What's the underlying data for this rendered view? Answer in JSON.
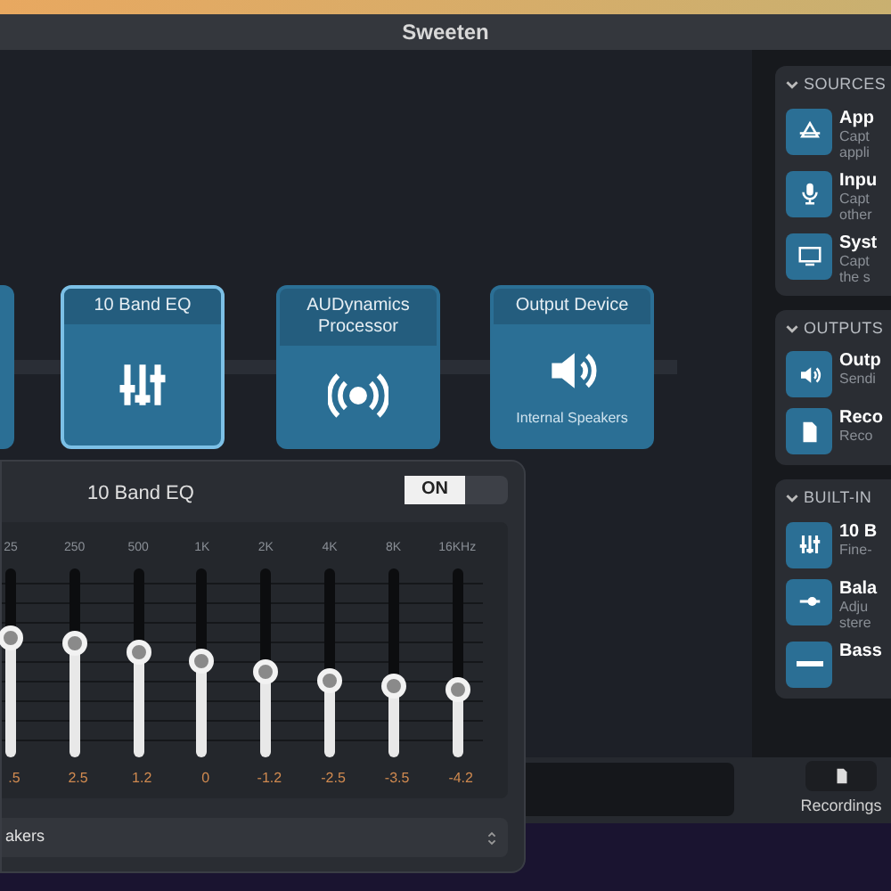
{
  "window": {
    "title": "Sweeten"
  },
  "chain": [
    {
      "title": "10 Band EQ",
      "kind": "sliders",
      "selected": true
    },
    {
      "title": "AUDynamics Processor",
      "kind": "broadcast",
      "selected": false
    },
    {
      "title": "Output Device",
      "kind": "speaker",
      "subtitle": "Internal Speakers",
      "selected": false
    }
  ],
  "eq": {
    "title": "10 Band EQ",
    "toggle": {
      "label": "ON",
      "on": true
    },
    "bands": [
      {
        "freq": "25",
        "value": ".5",
        "level": 0.63
      },
      {
        "freq": "250",
        "value": "2.5",
        "level": 0.6
      },
      {
        "freq": "500",
        "value": "1.2",
        "level": 0.56
      },
      {
        "freq": "1K",
        "value": "0",
        "level": 0.51
      },
      {
        "freq": "2K",
        "value": "-1.2",
        "level": 0.45
      },
      {
        "freq": "4K",
        "value": "-2.5",
        "level": 0.41
      },
      {
        "freq": "8K",
        "value": "-3.5",
        "level": 0.38
      },
      {
        "freq": "16KHz",
        "value": "-4.2",
        "level": 0.36
      }
    ],
    "device": "akers"
  },
  "sidebar": [
    {
      "header": "SOURCES",
      "expanded": true,
      "items": [
        {
          "kind": "app",
          "title": "App",
          "lines": [
            "Capt",
            "appli"
          ]
        },
        {
          "kind": "mic",
          "title": "Inpu",
          "lines": [
            "Capt",
            "other"
          ]
        },
        {
          "kind": "monitor",
          "title": "Syst",
          "lines": [
            "Capt",
            "the s"
          ]
        }
      ]
    },
    {
      "header": "OUTPUTS",
      "expanded": true,
      "items": [
        {
          "kind": "speaker",
          "title": "Outp",
          "lines": [
            "Sendi"
          ]
        },
        {
          "kind": "file",
          "title": "Reco",
          "lines": [
            "Reco"
          ]
        }
      ]
    },
    {
      "header": "BUILT-IN",
      "expanded": true,
      "items": [
        {
          "kind": "sliders",
          "title": "10 B",
          "lines": [
            "Fine-"
          ]
        },
        {
          "kind": "balance",
          "title": "Bala",
          "lines": [
            "Adju",
            "stere"
          ]
        },
        {
          "kind": "bass",
          "title": "Bass"
        }
      ]
    }
  ],
  "bottom": {
    "recordings": "Recordings"
  }
}
